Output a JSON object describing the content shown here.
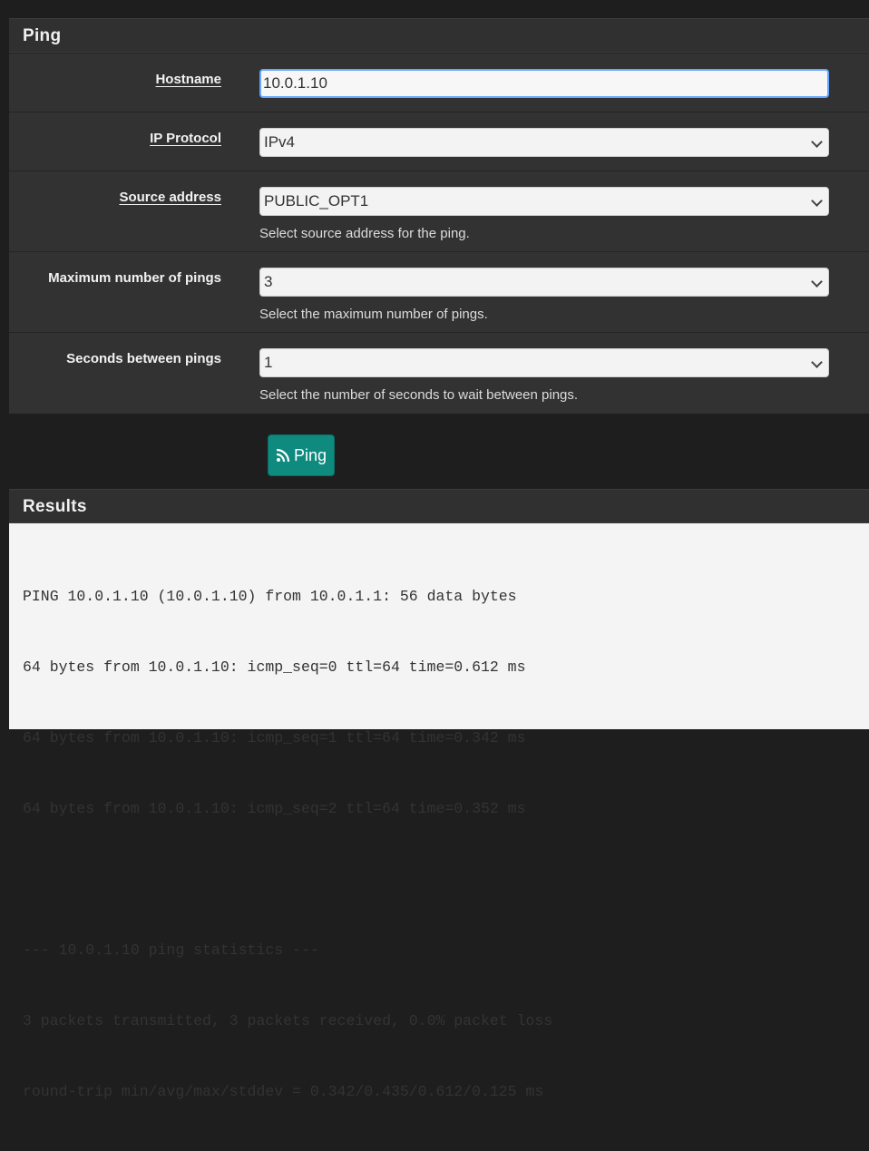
{
  "ping_panel": {
    "title": "Ping",
    "hostname": {
      "label": "Hostname",
      "value": "10.0.1.10"
    },
    "ip_protocol": {
      "label": "IP Protocol",
      "value": "IPv4"
    },
    "source_address": {
      "label": "Source address",
      "value": "PUBLIC_OPT1",
      "help": "Select source address for the ping."
    },
    "max_pings": {
      "label": "Maximum number of pings",
      "value": "3",
      "help": "Select the maximum number of pings."
    },
    "seconds_between": {
      "label": "Seconds between pings",
      "value": "1",
      "help": "Select the number of seconds to wait between pings."
    }
  },
  "actions": {
    "ping_label": "Ping",
    "ping_icon": "rss-icon"
  },
  "results_panel": {
    "title": "Results",
    "lines": [
      "PING 10.0.1.10 (10.0.1.10) from 10.0.1.1: 56 data bytes",
      "64 bytes from 10.0.1.10: icmp_seq=0 ttl=64 time=0.612 ms",
      "64 bytes from 10.0.1.10: icmp_seq=1 ttl=64 time=0.342 ms",
      "64 bytes from 10.0.1.10: icmp_seq=2 ttl=64 time=0.352 ms",
      "",
      "--- 10.0.1.10 ping statistics ---",
      "3 packets transmitted, 3 packets received, 0.0% packet loss",
      "round-trip min/avg/max/stddev = 0.342/0.435/0.612/0.125 ms"
    ]
  }
}
